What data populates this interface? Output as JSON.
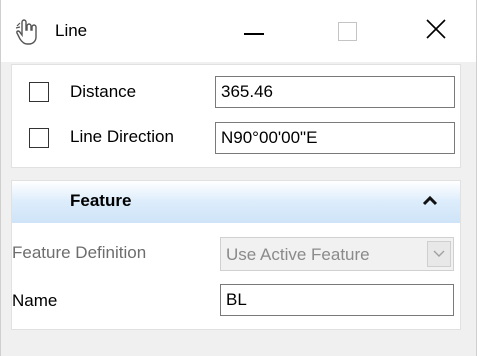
{
  "window": {
    "title": "Line",
    "app_icon": "hand-pointer-icon",
    "controls": [
      "minimize-icon",
      "maximize-icon",
      "close-icon"
    ]
  },
  "fields": {
    "distance": {
      "label": "Distance",
      "value": "365.46",
      "checked": false
    },
    "line_direction": {
      "label": "Line Direction",
      "value": "N90°00'00\"E",
      "checked": false
    }
  },
  "feature": {
    "title": "Feature",
    "collapse_icon": "chevron-up-icon",
    "definition_label": "Feature Definition",
    "definition_value": "Use Active Feature",
    "name_label": "Name",
    "name_value": "BL"
  },
  "colors": {
    "header_gradient_bottom": "#cfe4f8",
    "disabled_text": "#8a8a8a"
  }
}
